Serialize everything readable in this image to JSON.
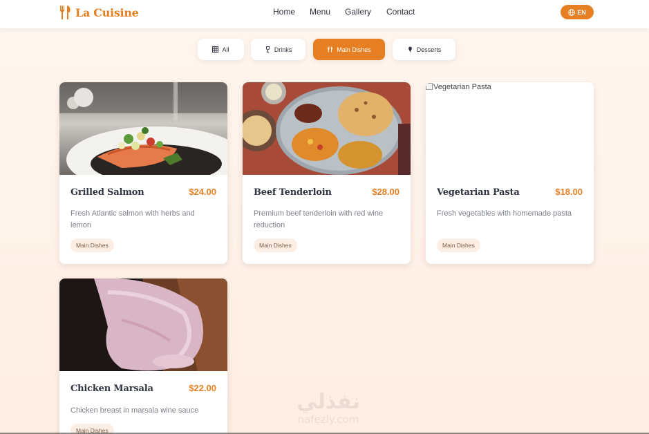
{
  "brand": {
    "name": "La Cuisine",
    "icon": "utensils-icon",
    "color": "#e67e22"
  },
  "nav": {
    "links": [
      "Home",
      "Menu",
      "Gallery",
      "Contact"
    ]
  },
  "language": {
    "label": "EN",
    "icon": "globe-icon"
  },
  "filters": [
    {
      "label": "All",
      "icon": "grid-icon",
      "active": false
    },
    {
      "label": "Drinks",
      "icon": "wine-glass-icon",
      "active": false
    },
    {
      "label": "Main Dishes",
      "icon": "utensils-icon",
      "active": true
    },
    {
      "label": "Desserts",
      "icon": "ice-cream-icon",
      "active": false
    }
  ],
  "menu_items": [
    {
      "name": "Grilled Salmon",
      "price": "$24.00",
      "description": "Fresh Atlantic salmon with herbs and lemon",
      "category": "Main Dishes",
      "image": "photo"
    },
    {
      "name": "Beef Tenderloin",
      "price": "$28.00",
      "description": "Premium beef tenderloin with red wine reduction",
      "category": "Main Dishes",
      "image": "photo"
    },
    {
      "name": "Vegetarian Pasta",
      "price": "$18.00",
      "description": "Fresh vegetables with homemade pasta",
      "category": "Main Dishes",
      "image_alt": "Vegetarian Pasta",
      "image": "broken"
    },
    {
      "name": "Chicken Marsala",
      "price": "$22.00",
      "description": "Chicken breast in marsala wine sauce",
      "category": "Main Dishes",
      "image": "photo"
    }
  ],
  "watermark": {
    "arabic": "نفذلي",
    "latin": "nafezly.com"
  },
  "colors": {
    "accent": "#e67e22",
    "text": "#2f3440",
    "muted": "#7b7f88",
    "badge_bg": "#fdeee3"
  }
}
